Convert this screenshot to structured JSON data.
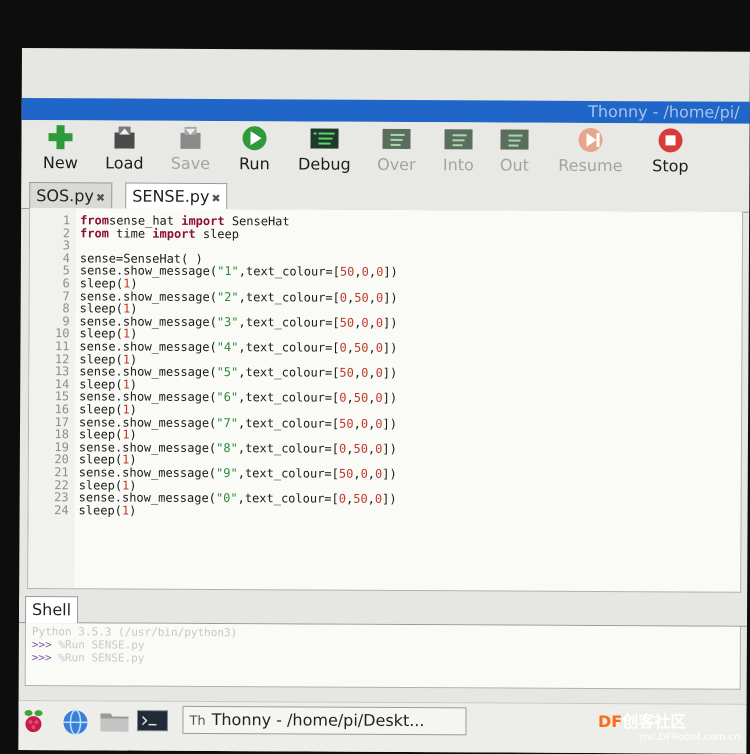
{
  "window": {
    "title": "Thonny  -  /home/pi/"
  },
  "toolbar": {
    "new": "New",
    "load": "Load",
    "save": "Save",
    "run": "Run",
    "debug": "Debug",
    "over": "Over",
    "into": "Into",
    "out": "Out",
    "resume": "Resume",
    "stop": "Stop"
  },
  "tabs": [
    {
      "label": "SOS.py",
      "close": "✖"
    },
    {
      "label": "SENSE.py",
      "close": "✖"
    }
  ],
  "editor": {
    "lines": [
      {
        "n": "1",
        "tokens": [
          [
            "kw",
            "from"
          ],
          [
            "",
            "sense_hat "
          ],
          [
            "kw",
            "import"
          ],
          [
            "",
            " SenseHat"
          ]
        ]
      },
      {
        "n": "2",
        "tokens": [
          [
            "kw",
            "from"
          ],
          [
            "",
            " time "
          ],
          [
            "kw",
            "import"
          ],
          [
            "",
            " sleep"
          ]
        ]
      },
      {
        "n": "3",
        "tokens": []
      },
      {
        "n": "4",
        "tokens": [
          [
            "",
            "sense=SenseHat( )"
          ]
        ]
      },
      {
        "n": "5",
        "tokens": [
          [
            "",
            "sense.show_message("
          ],
          [
            "str",
            "\"1\""
          ],
          [
            "",
            ",text_colour=["
          ],
          [
            "num",
            "50"
          ],
          [
            "",
            ","
          ],
          [
            "num",
            "0"
          ],
          [
            "",
            ","
          ],
          [
            "num",
            "0"
          ],
          [
            "",
            "])"
          ]
        ]
      },
      {
        "n": "6",
        "tokens": [
          [
            "",
            "sleep("
          ],
          [
            "num",
            "1"
          ],
          [
            "",
            ")"
          ]
        ]
      },
      {
        "n": "7",
        "tokens": [
          [
            "",
            "sense.show_message("
          ],
          [
            "str",
            "\"2\""
          ],
          [
            "",
            ",text_colour=["
          ],
          [
            "num",
            "0"
          ],
          [
            "",
            ","
          ],
          [
            "num",
            "50"
          ],
          [
            "",
            ","
          ],
          [
            "num",
            "0"
          ],
          [
            "",
            "])"
          ]
        ]
      },
      {
        "n": "8",
        "tokens": [
          [
            "",
            "sleep("
          ],
          [
            "num",
            "1"
          ],
          [
            "",
            ")"
          ]
        ]
      },
      {
        "n": "9",
        "tokens": [
          [
            "",
            "sense.show_message("
          ],
          [
            "str",
            "\"3\""
          ],
          [
            "",
            ",text_colour=["
          ],
          [
            "num",
            "50"
          ],
          [
            "",
            ","
          ],
          [
            "num",
            "0"
          ],
          [
            "",
            ","
          ],
          [
            "num",
            "0"
          ],
          [
            "",
            "])"
          ]
        ]
      },
      {
        "n": "10",
        "tokens": [
          [
            "",
            "sleep("
          ],
          [
            "num",
            "1"
          ],
          [
            "",
            ")"
          ]
        ]
      },
      {
        "n": "11",
        "tokens": [
          [
            "",
            "sense.show_message("
          ],
          [
            "str",
            "\"4\""
          ],
          [
            "",
            ",text_colour=["
          ],
          [
            "num",
            "0"
          ],
          [
            "",
            ","
          ],
          [
            "num",
            "50"
          ],
          [
            "",
            ","
          ],
          [
            "num",
            "0"
          ],
          [
            "",
            "])"
          ]
        ]
      },
      {
        "n": "12",
        "tokens": [
          [
            "",
            "sleep("
          ],
          [
            "num",
            "1"
          ],
          [
            "",
            ")"
          ]
        ]
      },
      {
        "n": "13",
        "tokens": [
          [
            "",
            "sense.show_message("
          ],
          [
            "str",
            "\"5\""
          ],
          [
            "",
            ",text_colour=["
          ],
          [
            "num",
            "50"
          ],
          [
            "",
            ","
          ],
          [
            "num",
            "0"
          ],
          [
            "",
            ","
          ],
          [
            "num",
            "0"
          ],
          [
            "",
            "])"
          ]
        ]
      },
      {
        "n": "14",
        "tokens": [
          [
            "",
            "sleep("
          ],
          [
            "num",
            "1"
          ],
          [
            "",
            ")"
          ]
        ]
      },
      {
        "n": "15",
        "tokens": [
          [
            "",
            "sense.show_message("
          ],
          [
            "str",
            "\"6\""
          ],
          [
            "",
            ",text_colour=["
          ],
          [
            "num",
            "0"
          ],
          [
            "",
            ","
          ],
          [
            "num",
            "50"
          ],
          [
            "",
            ","
          ],
          [
            "num",
            "0"
          ],
          [
            "",
            "])"
          ]
        ]
      },
      {
        "n": "16",
        "tokens": [
          [
            "",
            "sleep("
          ],
          [
            "num",
            "1"
          ],
          [
            "",
            ")"
          ]
        ]
      },
      {
        "n": "17",
        "tokens": [
          [
            "",
            "sense.show_message("
          ],
          [
            "str",
            "\"7\""
          ],
          [
            "",
            ",text_colour=["
          ],
          [
            "num",
            "50"
          ],
          [
            "",
            ","
          ],
          [
            "num",
            "0"
          ],
          [
            "",
            ","
          ],
          [
            "num",
            "0"
          ],
          [
            "",
            "])"
          ]
        ]
      },
      {
        "n": "18",
        "tokens": [
          [
            "",
            "sleep("
          ],
          [
            "num",
            "1"
          ],
          [
            "",
            ")"
          ]
        ]
      },
      {
        "n": "19",
        "tokens": [
          [
            "",
            "sense.show_message("
          ],
          [
            "str",
            "\"8\""
          ],
          [
            "",
            ",text_colour=["
          ],
          [
            "num",
            "0"
          ],
          [
            "",
            ","
          ],
          [
            "num",
            "50"
          ],
          [
            "",
            ","
          ],
          [
            "num",
            "0"
          ],
          [
            "",
            "])"
          ]
        ]
      },
      {
        "n": "20",
        "tokens": [
          [
            "",
            "sleep("
          ],
          [
            "num",
            "1"
          ],
          [
            "",
            ")"
          ]
        ]
      },
      {
        "n": "21",
        "tokens": [
          [
            "",
            "sense.show_message("
          ],
          [
            "str",
            "\"9\""
          ],
          [
            "",
            ",text_colour=["
          ],
          [
            "num",
            "50"
          ],
          [
            "",
            ","
          ],
          [
            "num",
            "0"
          ],
          [
            "",
            ","
          ],
          [
            "num",
            "0"
          ],
          [
            "",
            "])"
          ]
        ]
      },
      {
        "n": "22",
        "tokens": [
          [
            "",
            "sleep("
          ],
          [
            "num",
            "1"
          ],
          [
            "",
            ")"
          ]
        ]
      },
      {
        "n": "23",
        "tokens": [
          [
            "",
            "sense.show_message("
          ],
          [
            "str",
            "\"0\""
          ],
          [
            "",
            ",text_colour=["
          ],
          [
            "num",
            "0"
          ],
          [
            "",
            ","
          ],
          [
            "num",
            "50"
          ],
          [
            "",
            ","
          ],
          [
            "num",
            "0"
          ],
          [
            "",
            "])"
          ]
        ]
      },
      {
        "n": "24",
        "tokens": [
          [
            "",
            "sleep("
          ],
          [
            "num",
            "1"
          ],
          [
            "",
            ")"
          ]
        ]
      }
    ]
  },
  "shell": {
    "tab": "Shell",
    "version": "Python 3.5.3 (/usr/bin/python3)",
    "prompt": ">>>",
    "cmd1": " %Run SENSE.py",
    "cmd2": " %Run SENSE.py"
  },
  "taskbar": {
    "task_icon": "Th",
    "task_label": "Thonny  -  /home/pi/Deskt..."
  },
  "watermark": {
    "logo": "DF",
    "cn": "创客社区",
    "url": "mc.DFRobot.com.cn"
  },
  "colors": {
    "titlebar": "#1f66c8",
    "keyword": "#8a0d3a",
    "string": "#2b8a3e",
    "number": "#c0392b"
  }
}
